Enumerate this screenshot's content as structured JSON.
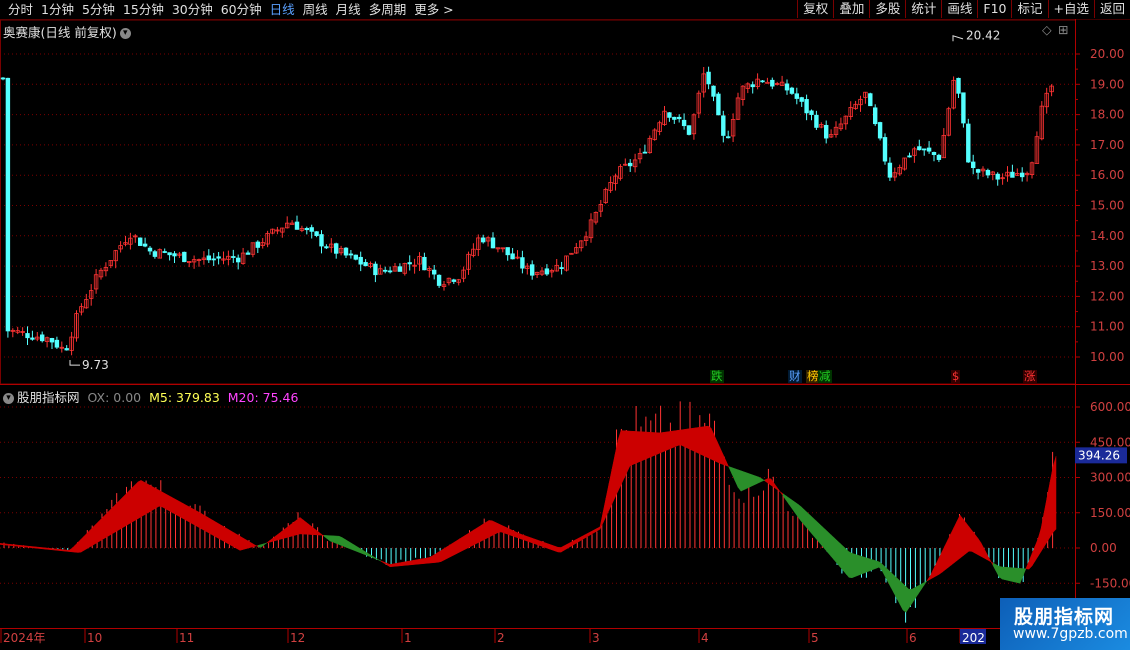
{
  "toolbar": {
    "periods": [
      "分时",
      "1分钟",
      "5分钟",
      "15分钟",
      "30分钟",
      "60分钟",
      "日线",
      "周线",
      "月线",
      "多周期",
      "更多 >"
    ],
    "active_period": "日线",
    "actions": [
      "复权",
      "叠加",
      "多股",
      "统计",
      "画线",
      "F10",
      "标记",
      "+自选",
      "返回"
    ]
  },
  "main_panel": {
    "title": "奥赛康(日线 前复权)",
    "high_marker": "20.42",
    "low_marker": "9.73",
    "y_ticks": [
      "20.00",
      "19.00",
      "18.00",
      "17.00",
      "16.00",
      "15.00",
      "14.00",
      "13.00",
      "12.00",
      "11.00",
      "10.00"
    ],
    "event_badges": [
      {
        "text": "跌",
        "color": "#22cc22",
        "bg": "#003300"
      },
      {
        "text": "财",
        "color": "#5aa0ff",
        "bg": "#001a33"
      },
      {
        "text": "榜",
        "color": "#ffcc00",
        "bg": "#332200"
      },
      {
        "text": "减",
        "color": "#22cc22",
        "bg": "#003300"
      },
      {
        "text": "$",
        "color": "#ff3333",
        "bg": "#330000"
      },
      {
        "text": "涨",
        "color": "#ff3333",
        "bg": "#330000"
      }
    ]
  },
  "indicator_panel": {
    "title": "股朋指标网",
    "ox_label": "OX: 0.00",
    "m5_label": "M5: 379.83",
    "m20_label": "M20: 75.46",
    "y_ticks": [
      "600.00",
      "450.00",
      "300.00",
      "150.00",
      "0.00",
      "-150.00"
    ],
    "current_value": "394.26"
  },
  "date_axis": {
    "labels": [
      "2024年",
      "10",
      "11",
      "12",
      "1",
      "2",
      "3",
      "4",
      "5",
      "6",
      "202"
    ]
  },
  "watermark": {
    "line1": "股朋指标网",
    "line2": "www.7gpzb.com"
  },
  "colors": {
    "up": "#ff3333",
    "down": "#54ffff",
    "grid": "#7a0000",
    "fill_up": "#cc0000",
    "fill_down": "#2a8f2a"
  }
}
